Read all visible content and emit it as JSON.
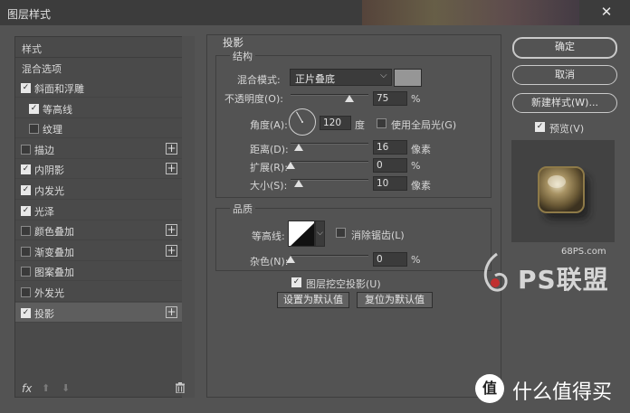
{
  "window": {
    "title": "图层样式",
    "close_glyph": "✕"
  },
  "left_panel": {
    "header": "样式",
    "blend_options": "混合选项",
    "items": [
      {
        "label": "斜面和浮雕",
        "checked": true,
        "plus": false,
        "indent": false
      },
      {
        "label": "等高线",
        "checked": true,
        "plus": false,
        "indent": true
      },
      {
        "label": "纹理",
        "checked": false,
        "plus": false,
        "indent": true
      },
      {
        "label": "描边",
        "checked": false,
        "plus": true,
        "indent": false
      },
      {
        "label": "内阴影",
        "checked": true,
        "plus": true,
        "indent": false
      },
      {
        "label": "内发光",
        "checked": true,
        "plus": false,
        "indent": false
      },
      {
        "label": "光泽",
        "checked": true,
        "plus": false,
        "indent": false
      },
      {
        "label": "颜色叠加",
        "checked": false,
        "plus": true,
        "indent": false
      },
      {
        "label": "渐变叠加",
        "checked": false,
        "plus": true,
        "indent": false
      },
      {
        "label": "图案叠加",
        "checked": false,
        "plus": false,
        "indent": false
      },
      {
        "label": "外发光",
        "checked": false,
        "plus": false,
        "indent": false
      },
      {
        "label": "投影",
        "checked": true,
        "plus": true,
        "indent": false,
        "selected": true
      }
    ],
    "footer": {
      "fx": "fx",
      "up": "⬆",
      "down": "⬇",
      "trash": "🗑"
    }
  },
  "drop_shadow": {
    "section_title": "投影",
    "structure": {
      "title": "结构",
      "blend_mode_label": "混合模式:",
      "blend_mode_value": "正片叠底",
      "shadow_color": "#969696",
      "opacity_label": "不透明度(O):",
      "opacity_value": "75",
      "opacity_unit": "%",
      "opacity": 75,
      "angle_label": "角度(A):",
      "angle_value": "120",
      "angle_unit": "度",
      "angle": 120,
      "global_light_label": "使用全局光(G)",
      "global_light_checked": false,
      "distance_label": "距离(D):",
      "distance_value": "16",
      "distance_unit": "像素",
      "distance": 16,
      "spread_label": "扩展(R):",
      "spread_value": "0",
      "spread_unit": "%",
      "spread": 0,
      "size_label": "大小(S):",
      "size_value": "10",
      "size_unit": "像素",
      "size": 10
    },
    "quality": {
      "title": "品质",
      "contour_label": "等高线:",
      "antialias_label": "消除锯齿(L)",
      "antialias_checked": false,
      "noise_label": "杂色(N):",
      "noise_value": "0",
      "noise_unit": "%",
      "noise": 0
    },
    "knockout_label": "图层挖空投影(U)",
    "knockout_checked": true,
    "make_default": "设置为默认值",
    "reset_default": "复位为默认值"
  },
  "right_panel": {
    "ok": "确定",
    "cancel": "取消",
    "new_style": "新建样式(W)...",
    "preview_label": "预览(V)",
    "preview_checked": true
  },
  "watermarks": {
    "site": "68PS.com",
    "brand": "PS联盟",
    "badge": "值",
    "slogan": "什么值得买"
  },
  "colors": {
    "accent": "#e8e8e8",
    "panel_bg": "#535353",
    "selected_row": "#5e5e5e"
  }
}
